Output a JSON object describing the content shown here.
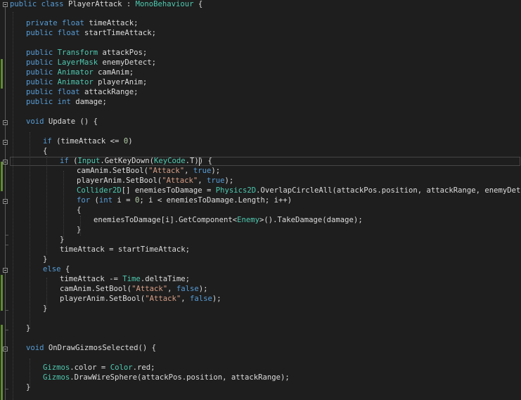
{
  "editor": {
    "tokens": {
      "public": "public",
      "private": "private",
      "class": "class",
      "float": "float",
      "int": "int",
      "void": "void",
      "if": "if",
      "else": "else",
      "for": "for",
      "true": "true",
      "false": "false"
    },
    "types": {
      "mono_behaviour": "MonoBehaviour",
      "transform": "Transform",
      "layer_mask": "LayerMask",
      "animator": "Animator",
      "input": "Input",
      "key_code": "KeyCode",
      "collider2d": "Collider2D",
      "physics2d": "Physics2D",
      "enemy": "Enemy",
      "time": "Time",
      "gizmos": "Gizmos",
      "color": "Color"
    },
    "strings": {
      "attack": "\"Attack\""
    },
    "numbers": {
      "zero": "0"
    },
    "text": {
      "class_name": " PlayerAttack : ",
      "brace_open": " {",
      "time_attack_field": " timeAttack;",
      "start_time_attack_field": " startTimeAttack;",
      "attack_pos_field": " attackPos;",
      "enemy_detect_field": " enemyDetect;",
      "cam_anim_field": " camAnim;",
      "player_anim_field": " playerAnim;",
      "attack_range_field": " attackRange;",
      "damage_field": " damage;",
      "update_sig": " Update () {",
      "if_open": " (timeAttack <= ",
      "paren_close": ")",
      "open_brace": "{",
      "close_brace": "}",
      "if_input_open": " (",
      "get_key_down": ".GetKeyDown(",
      "key_t": ".T)) {",
      "cam_set_bool": "camAnim.SetBool(",
      "player_set_bool": "playerAnim.SetBool(",
      "comma_space": ", ",
      "end_call": ");",
      "enemies_decl": "[] enemiesToDamage = ",
      "overlap_call": ".OverlapCircleAll(attackPos.position, attackRange, enemyDetect);",
      "for_open": " (",
      "for_mid": " i = ",
      "for_rest": "; i < enemiesToDamage.Length; i++)",
      "get_component": "enemiesToDamage[i].GetComponent<",
      "take_damage": ">().TakeDamage(damage);",
      "time_attack_reset": "timeAttack = startTimeAttack;",
      "else_brace": " {",
      "time_attack_minus": "timeAttack -= ",
      "delta_time": ".deltaTime;",
      "gizmos_sig": " OnDrawGizmosSelected() {",
      "color_assign": ".color = ",
      "red": ".red;",
      "draw_wire_sphere": ".DrawWireSphere(attackPos.position, attackRange);"
    }
  }
}
